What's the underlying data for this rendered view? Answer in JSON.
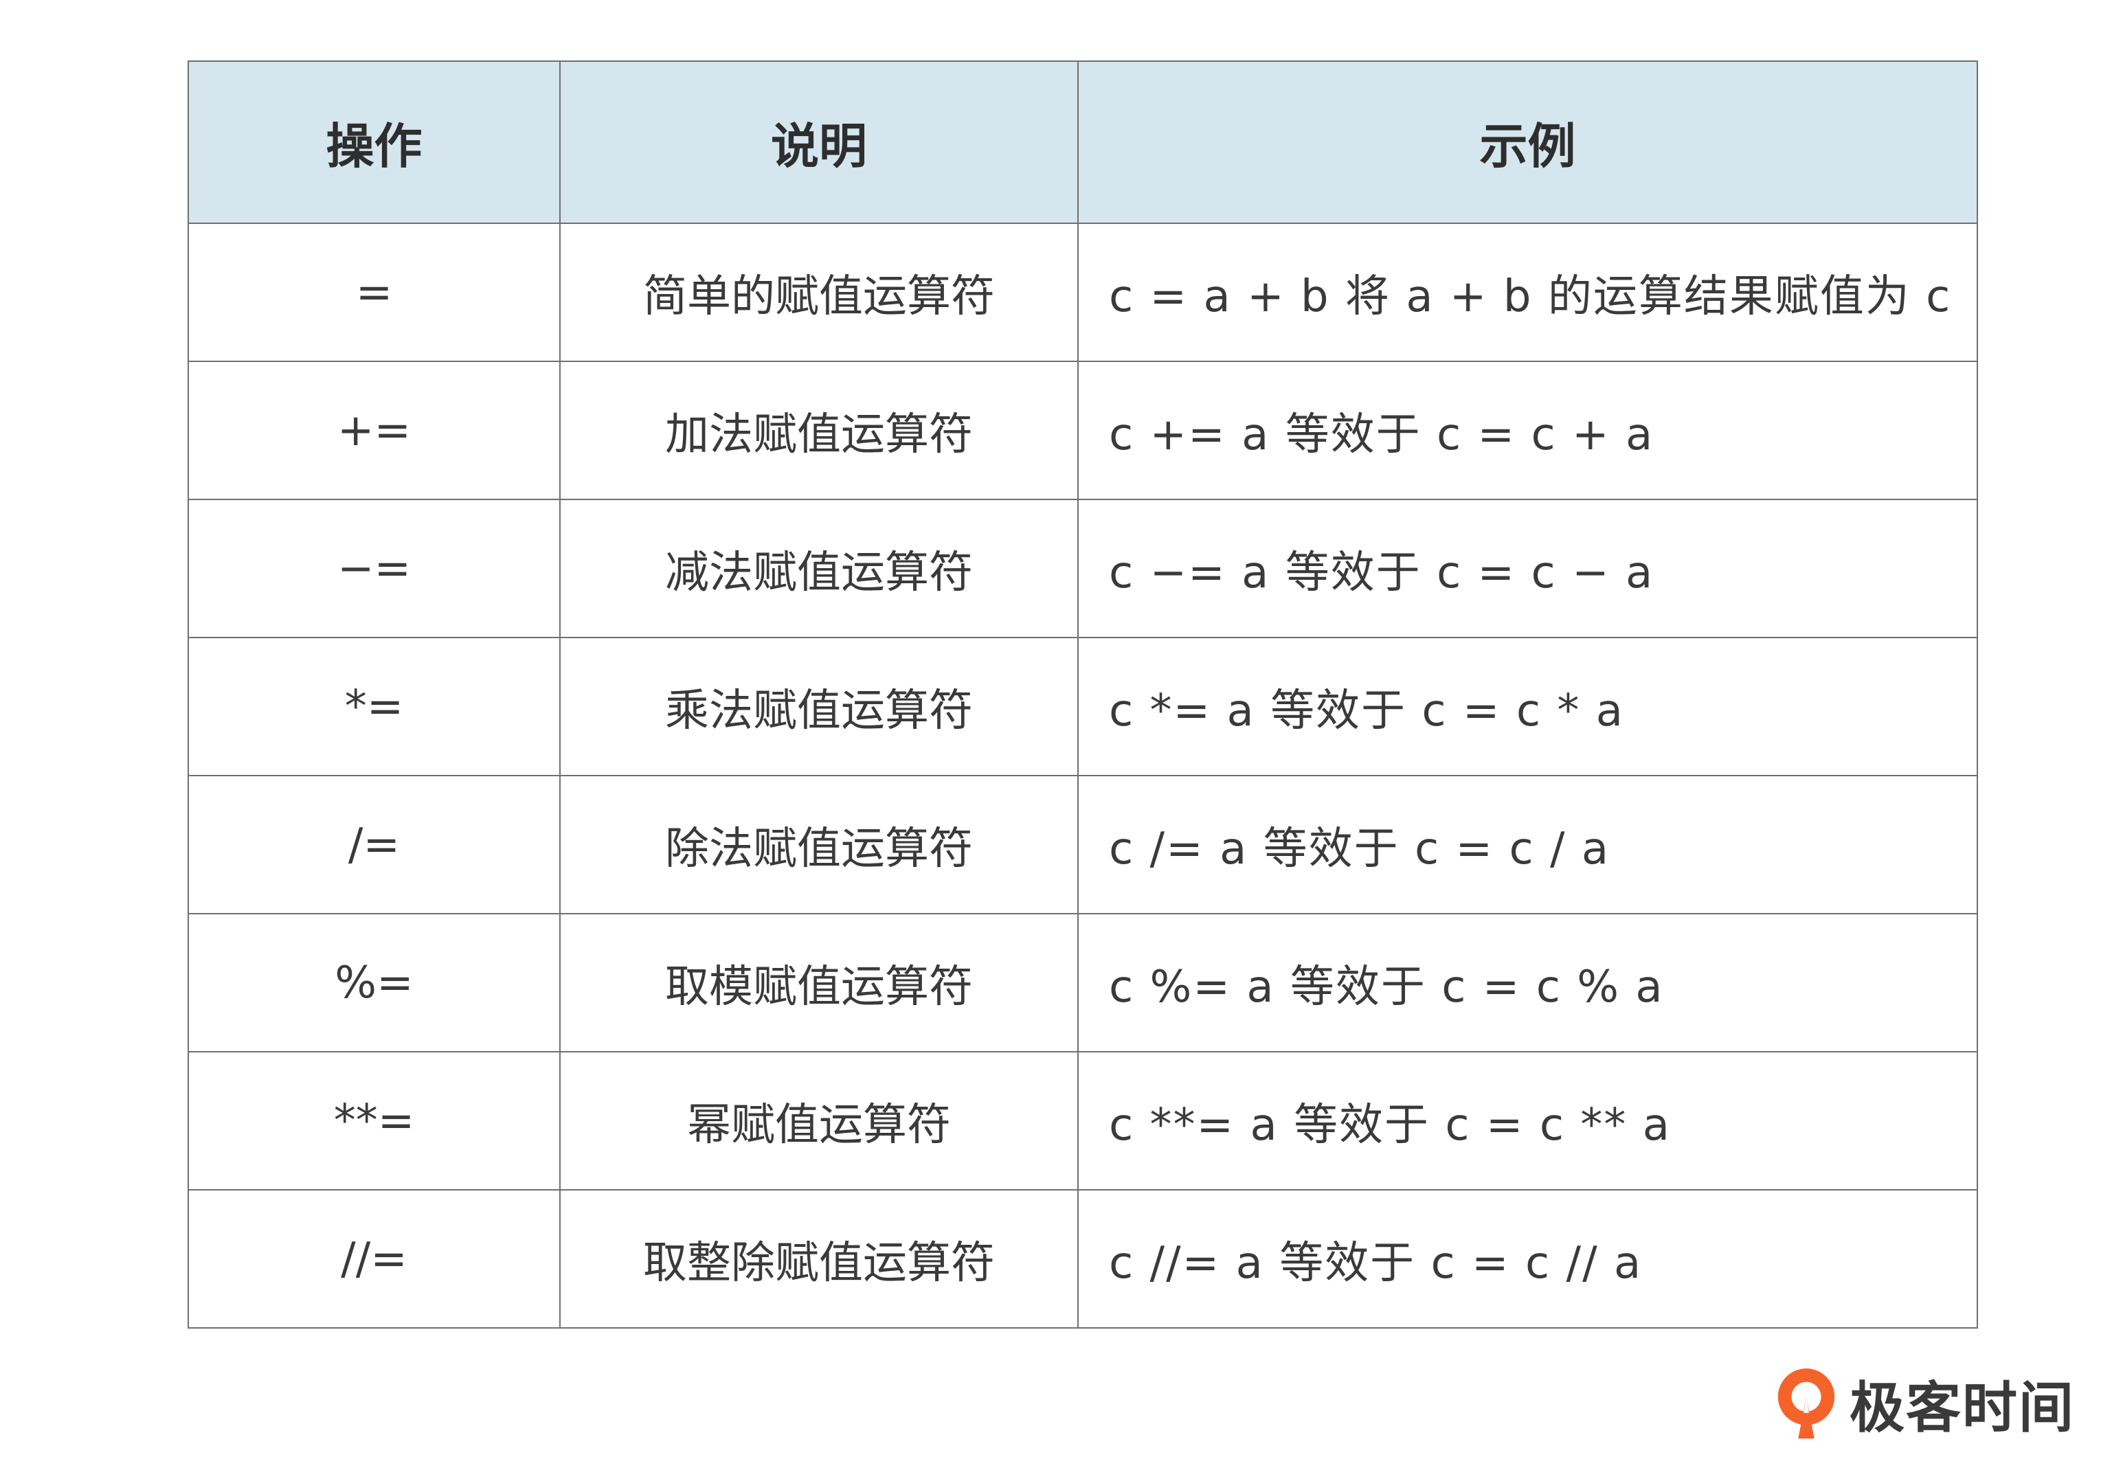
{
  "table": {
    "headers": [
      "操作",
      "说明",
      "示例"
    ],
    "rows": [
      {
        "op": "=",
        "desc": "简单的赋值运算符",
        "example": "c = a + b 将 a + b 的运算结果赋值为 c"
      },
      {
        "op": "+=",
        "desc": "加法赋值运算符",
        "example": "c += a 等效于 c = c + a"
      },
      {
        "op": "−=",
        "desc": "减法赋值运算符",
        "example": "c −= a 等效于 c = c − a"
      },
      {
        "op": "*=",
        "desc": "乘法赋值运算符",
        "example": "c *= a 等效于 c = c * a"
      },
      {
        "op": "/=",
        "desc": "除法赋值运算符",
        "example": "c /= a 等效于 c = c / a"
      },
      {
        "op": "%=",
        "desc": "取模赋值运算符",
        "example": "c %= a 等效于 c = c % a"
      },
      {
        "op": "**=",
        "desc": "幂赋值运算符",
        "example": "c **= a 等效于 c = c ** a"
      },
      {
        "op": "//=",
        "desc": "取整除赋值运算符",
        "example": "c //= a 等效于 c = c // a"
      }
    ]
  },
  "brand": {
    "name": "极客时间",
    "logo_icon": "geektime-logo-icon",
    "logo_color": "#f5632a"
  },
  "colors": {
    "header_bg": "#d5e6ee",
    "border": "#6f6f6f",
    "text": "#333333"
  }
}
